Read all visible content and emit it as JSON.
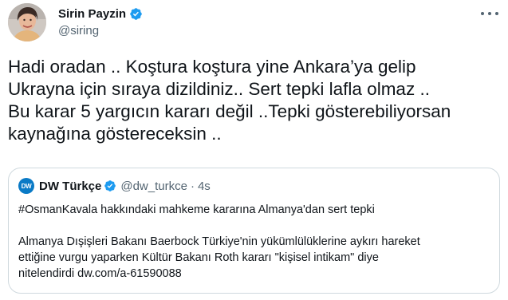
{
  "tweet": {
    "author_name": "Sirin Payzin",
    "author_handle": "@siring",
    "verified_icon": "verified-badge-icon",
    "more_icon": "more-options-icon",
    "body": "Hadi oradan .. Koştura koştura yine Ankara’ya gelip\nUkrayna için sıraya dizildiniz.. Sert tepki lafla olmaz ..\nBu karar 5 yargıcın kararı değil ..Tepki gösterebiliyorsan\nkaynağına göstereceksin .."
  },
  "quoted_tweet": {
    "logo_text": "DW",
    "author_name": "DW Türkçe",
    "author_handle": "@dw_turkce",
    "separator": "·",
    "time": "4s",
    "text": "#OsmanKavala hakkındaki mahkeme kararına Almanya'dan sert tepki\n\nAlmanya Dışişleri Bakanı Baerbock Türkiye'nin yükümlülüklerine aykırı hareket\nettiğine vurgu yaparken Kültür Bakanı Roth kararı \"kişisel intikam\" diye\nnitelendirdi dw.com/a-61590088"
  },
  "colors": {
    "verified": "#1d9bf0",
    "secondary_text": "#536471",
    "border": "#cfd9de",
    "dw_blue": "#0a7ac6"
  }
}
